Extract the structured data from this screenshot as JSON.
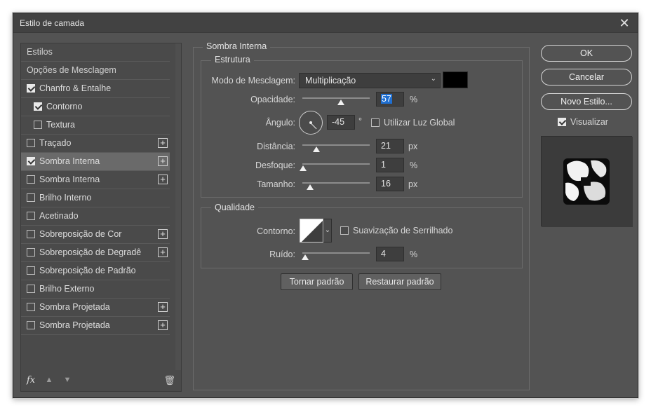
{
  "window": {
    "title": "Estilo de camada"
  },
  "sidebar": {
    "header1": "Estilos",
    "header2": "Opções de Mesclagem",
    "items": [
      {
        "label": "Chanfro & Entalhe",
        "checked": true,
        "plus": false,
        "sub": false,
        "active": false
      },
      {
        "label": "Contorno",
        "checked": true,
        "plus": false,
        "sub": true,
        "active": false
      },
      {
        "label": "Textura",
        "checked": false,
        "plus": false,
        "sub": true,
        "active": false
      },
      {
        "label": "Traçado",
        "checked": false,
        "plus": true,
        "sub": false,
        "active": false
      },
      {
        "label": "Sombra Interna",
        "checked": true,
        "plus": true,
        "sub": false,
        "active": true
      },
      {
        "label": "Sombra Interna",
        "checked": false,
        "plus": true,
        "sub": false,
        "active": false
      },
      {
        "label": "Brilho Interno",
        "checked": false,
        "plus": false,
        "sub": false,
        "active": false
      },
      {
        "label": "Acetinado",
        "checked": false,
        "plus": false,
        "sub": false,
        "active": false
      },
      {
        "label": "Sobreposição de Cor",
        "checked": false,
        "plus": true,
        "sub": false,
        "active": false
      },
      {
        "label": "Sobreposição de Degradê",
        "checked": false,
        "plus": true,
        "sub": false,
        "active": false
      },
      {
        "label": "Sobreposição de Padrão",
        "checked": false,
        "plus": false,
        "sub": false,
        "active": false
      },
      {
        "label": "Brilho Externo",
        "checked": false,
        "plus": false,
        "sub": false,
        "active": false
      },
      {
        "label": "Sombra Projetada",
        "checked": false,
        "plus": true,
        "sub": false,
        "active": false
      },
      {
        "label": "Sombra Projetada",
        "checked": false,
        "plus": true,
        "sub": false,
        "active": false
      }
    ],
    "footer": {
      "fx": "fx"
    }
  },
  "panel": {
    "title": "Sombra Interna",
    "structure": {
      "legend": "Estrutura",
      "blend_label": "Modo de Mesclagem:",
      "blend_value": "Multiplicação",
      "blend_color": "#000000",
      "opacity_label": "Opacidade:",
      "opacity_value": "57",
      "opacity_fraction": 0.57,
      "opacity_unit": "%",
      "angle_label": "Ângulo:",
      "angle_value": "-45",
      "angle_unit": "°",
      "global_light_label": "Utilizar Luz Global",
      "distance_label": "Distância:",
      "distance_value": "21",
      "distance_fraction": 0.21,
      "distance_unit": "px",
      "choke_label": "Desfoque:",
      "choke_value": "1",
      "choke_fraction": 0.01,
      "choke_unit": "%",
      "size_label": "Tamanho:",
      "size_value": "16",
      "size_fraction": 0.11,
      "size_unit": "px"
    },
    "quality": {
      "legend": "Qualidade",
      "contour_label": "Contorno:",
      "antialias_label": "Suavização de Serrilhado",
      "noise_label": "Ruído:",
      "noise_value": "4",
      "noise_fraction": 0.04,
      "noise_unit": "%"
    },
    "make_default": "Tornar padrão",
    "reset_default": "Restaurar padrão"
  },
  "buttons": {
    "ok": "OK",
    "cancel": "Cancelar",
    "new_style": "Novo Estilo...",
    "preview_label": "Visualizar"
  },
  "colors": {
    "accent_selection": "#1f6fd1",
    "window_bg": "#535353"
  }
}
